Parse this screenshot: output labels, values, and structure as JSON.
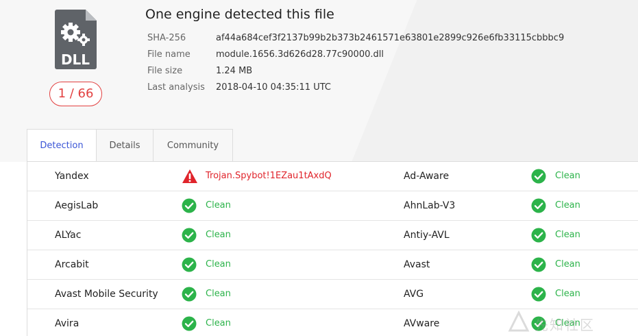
{
  "header": {
    "file_type": "DLL",
    "score": "1 / 66",
    "title": "One engine detected this file",
    "meta": [
      {
        "label": "SHA-256",
        "value": "af44a684cef3f2137b99b2b373b2461571e63801e2899c926e6fb33115cbbbc9"
      },
      {
        "label": "File name",
        "value": "module.1656.3d626d28.77c90000.dll"
      },
      {
        "label": "File size",
        "value": "1.24 MB"
      },
      {
        "label": "Last analysis",
        "value": "2018-04-10 04:35:11 UTC"
      }
    ]
  },
  "tabs": [
    {
      "label": "Detection",
      "active": true
    },
    {
      "label": "Details",
      "active": false
    },
    {
      "label": "Community",
      "active": false
    }
  ],
  "results": [
    {
      "left": {
        "engine": "Yandex",
        "status": "malicious",
        "result": "Trojan.Spybot!1EZau1tAxdQ"
      },
      "right": {
        "engine": "Ad-Aware",
        "status": "clean",
        "result": "Clean"
      }
    },
    {
      "left": {
        "engine": "AegisLab",
        "status": "clean",
        "result": "Clean"
      },
      "right": {
        "engine": "AhnLab-V3",
        "status": "clean",
        "result": "Clean"
      }
    },
    {
      "left": {
        "engine": "ALYac",
        "status": "clean",
        "result": "Clean"
      },
      "right": {
        "engine": "Antiy-AVL",
        "status": "clean",
        "result": "Clean"
      }
    },
    {
      "left": {
        "engine": "Arcabit",
        "status": "clean",
        "result": "Clean"
      },
      "right": {
        "engine": "Avast",
        "status": "clean",
        "result": "Clean"
      }
    },
    {
      "left": {
        "engine": "Avast Mobile Security",
        "status": "clean",
        "result": "Clean"
      },
      "right": {
        "engine": "AVG",
        "status": "clean",
        "result": "Clean"
      }
    },
    {
      "left": {
        "engine": "Avira",
        "status": "clean",
        "result": "Clean"
      },
      "right": {
        "engine": "AVware",
        "status": "clean",
        "result": "Clean"
      }
    }
  ],
  "icons": {
    "file": "dll-file-gear-icon",
    "clean": "check-circle-icon",
    "malicious": "warning-triangle-icon"
  },
  "colors": {
    "clean": "#2cb34a",
    "malicious": "#e0242b",
    "accent": "#3a55d6",
    "score": "#e24040"
  },
  "watermark": "先知社区"
}
